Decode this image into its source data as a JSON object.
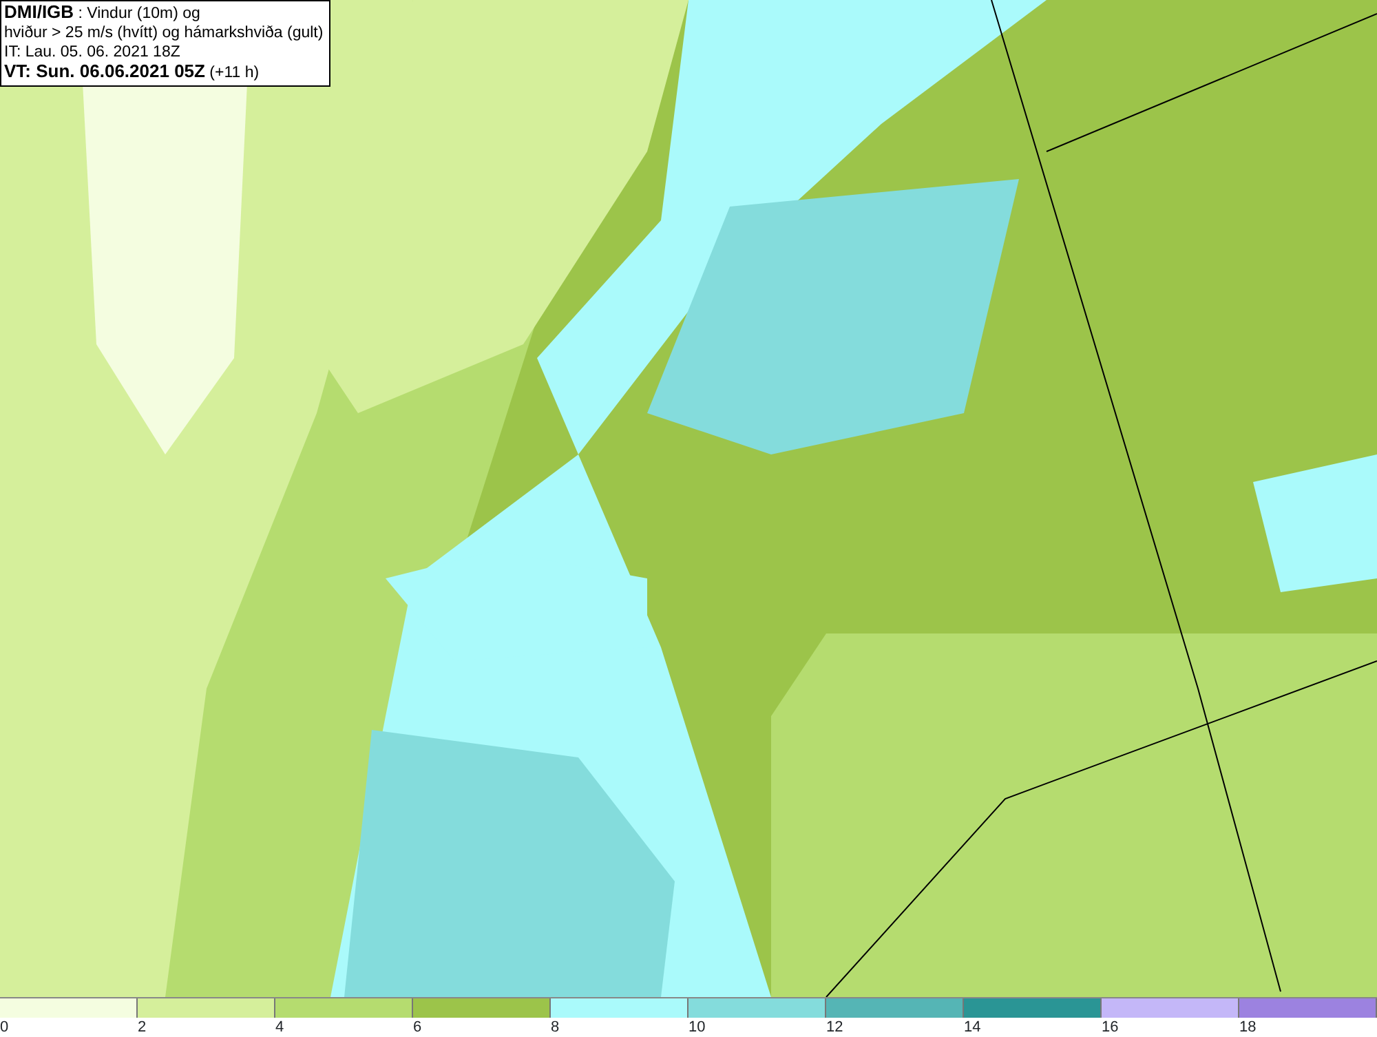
{
  "title_box": {
    "lines": [
      "**DMI/IGB** : Vindur (10m) og",
      "hviður > 25 m/s (hvítt) og hámarkshviða (gult)",
      "IT: Lau. 05. 06. 2021 18Z",
      "**VT: Sun. 06.06.2021 05Z** (+11 h)"
    ]
  },
  "legend": {
    "bins": [
      {
        "color": "#f4fde0",
        "label": "0"
      },
      {
        "color": "#d5ef9b",
        "label": "2"
      },
      {
        "color": "#b5dc6f",
        "label": "4"
      },
      {
        "color": "#9cc44a",
        "label": "6"
      },
      {
        "color": "#aafafb",
        "label": "8"
      },
      {
        "color": "#84dcdc",
        "label": "10"
      },
      {
        "color": "#55b5b5",
        "label": "12"
      },
      {
        "color": "#2a9595",
        "label": "14"
      },
      {
        "color": "#c4b7f8",
        "label": "16"
      },
      {
        "color": "#9c82e0",
        "label": "18"
      }
    ]
  }
}
